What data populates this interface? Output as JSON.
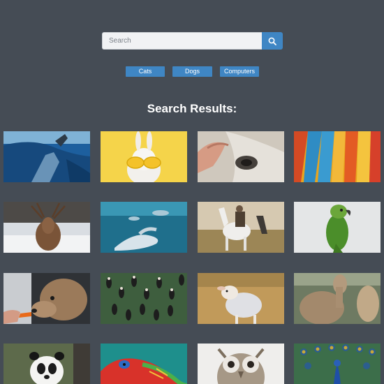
{
  "search": {
    "placeholder": "Search",
    "value": "",
    "button_icon": "search-icon"
  },
  "filters": [
    {
      "label": "Cats"
    },
    {
      "label": "Dogs"
    },
    {
      "label": "Computers"
    }
  ],
  "results_title": "Search Results:",
  "colors": {
    "background": "#454c55",
    "accent": "#3f86c4",
    "text": "#ffffff"
  },
  "results": [
    {
      "subject": "underwater-diver"
    },
    {
      "subject": "rabbit-with-sunglasses"
    },
    {
      "subject": "hand-petting-horse"
    },
    {
      "subject": "parrot-feathers"
    },
    {
      "subject": "deer-in-snow"
    },
    {
      "subject": "dolphins-underwater"
    },
    {
      "subject": "rider-on-horse"
    },
    {
      "subject": "green-parrot"
    },
    {
      "subject": "deer-eating-carrot"
    },
    {
      "subject": "birds-aerial"
    },
    {
      "subject": "lamb-in-coat"
    },
    {
      "subject": "alpacas"
    },
    {
      "subject": "panda"
    },
    {
      "subject": "chameleon"
    },
    {
      "subject": "owl"
    },
    {
      "subject": "peacock"
    }
  ]
}
